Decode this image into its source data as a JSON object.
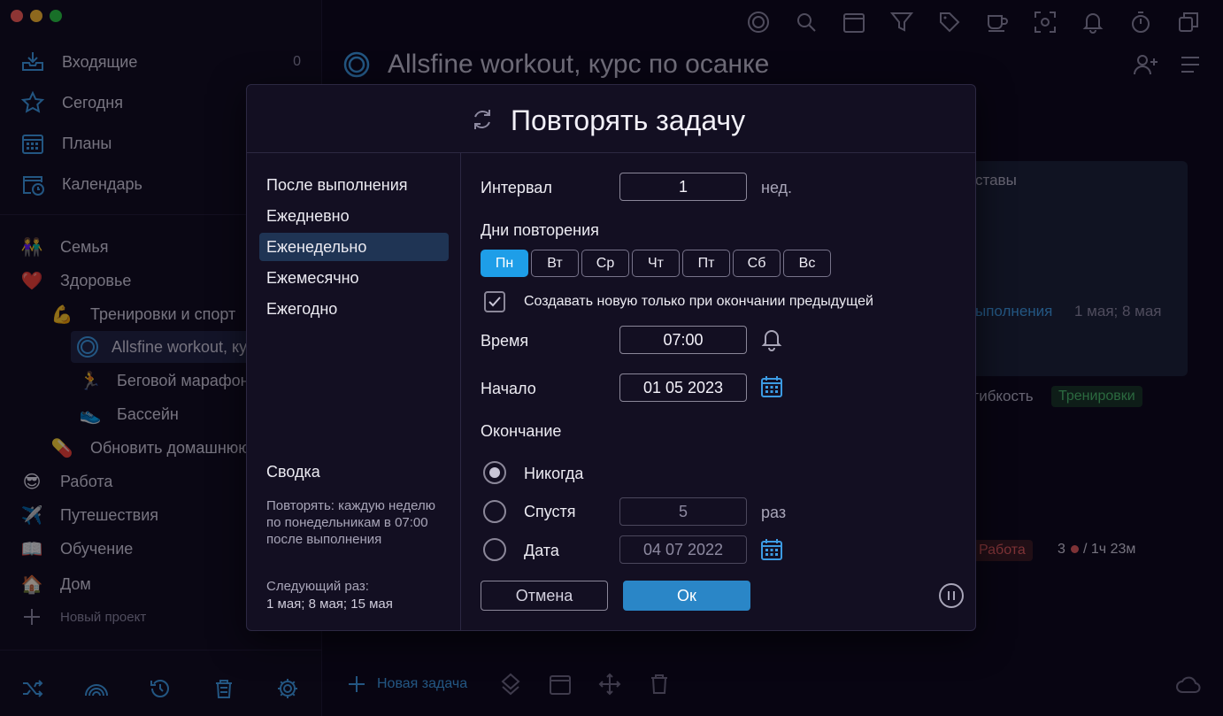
{
  "sidebar": {
    "nav": [
      {
        "label": "Входящие",
        "count": "0",
        "icon": "inbox-icon"
      },
      {
        "label": "Сегодня",
        "icon": "star-icon"
      },
      {
        "label": "Планы",
        "icon": "calendar-grid-icon"
      },
      {
        "label": "Календарь",
        "icon": "calendar-clock-icon"
      }
    ],
    "projects": [
      {
        "label": "Семья",
        "emoji": "👫"
      },
      {
        "label": "Здоровье",
        "emoji": "❤️"
      },
      {
        "label": "Тренировки и спорт",
        "emoji": "💪"
      },
      {
        "label": "Allsfine workout, курс по осанке",
        "emoji": ""
      },
      {
        "label": "Беговой марафон",
        "emoji": "🏃"
      },
      {
        "label": "Бассейн",
        "emoji": "👟"
      },
      {
        "label": "Обновить домашнюю аптечку",
        "emoji": "💊"
      },
      {
        "label": "Работа",
        "emoji": "😎"
      },
      {
        "label": "Путешествия",
        "emoji": "✈️"
      },
      {
        "label": "Обучение",
        "emoji": "📖"
      },
      {
        "label": "Дом",
        "emoji": "🏠"
      }
    ],
    "new_project": "Новый проект"
  },
  "main": {
    "title": "Allsfine workout, курс по осанке",
    "card": {
      "line1": "ставы",
      "repeat_link": "ыполнения",
      "dates": "1 мая; 8 мая",
      "line_flex": "гибкость",
      "tag_training": "Тренировки"
    },
    "row_work": {
      "tag": "Работа",
      "count": "3",
      "time": "/ 1ч 23м"
    },
    "new_task": "Новая задача"
  },
  "dialog": {
    "title": "Повторять задачу",
    "options": [
      "После выполнения",
      "Ежедневно",
      "Еженедельно",
      "Ежемесячно",
      "Ежегодно"
    ],
    "selected_option": "Еженедельно",
    "summary_title": "Сводка",
    "summary_text": "Повторять: каждую неделю по понедельникам в 07:00 после выполнения",
    "next_title": "Следующий раз:",
    "next_text": "1 мая; 8 мая; 15 мая",
    "interval_label": "Интервал",
    "interval_value": "1",
    "interval_unit": "нед.",
    "days_label": "Дни повторения",
    "days": [
      "Пн",
      "Вт",
      "Ср",
      "Чт",
      "Пт",
      "Сб",
      "Вс"
    ],
    "selected_day": "Пн",
    "checkbox_label": "Создавать новую только при окончании предыдущей",
    "time_label": "Время",
    "time_value": "07:00",
    "start_label": "Начало",
    "start_value": "01 05 2023",
    "end_label": "Окончание",
    "end_never": "Никогда",
    "end_after": "Спустя",
    "end_after_value": "5",
    "end_after_unit": "раз",
    "end_date": "Дата",
    "end_date_value": "04 07 2022",
    "cancel": "Отмена",
    "ok": "Ок"
  },
  "colors": {
    "accent": "#1e9ee8",
    "ok": "#2a86c7",
    "bg": "#130f22"
  }
}
